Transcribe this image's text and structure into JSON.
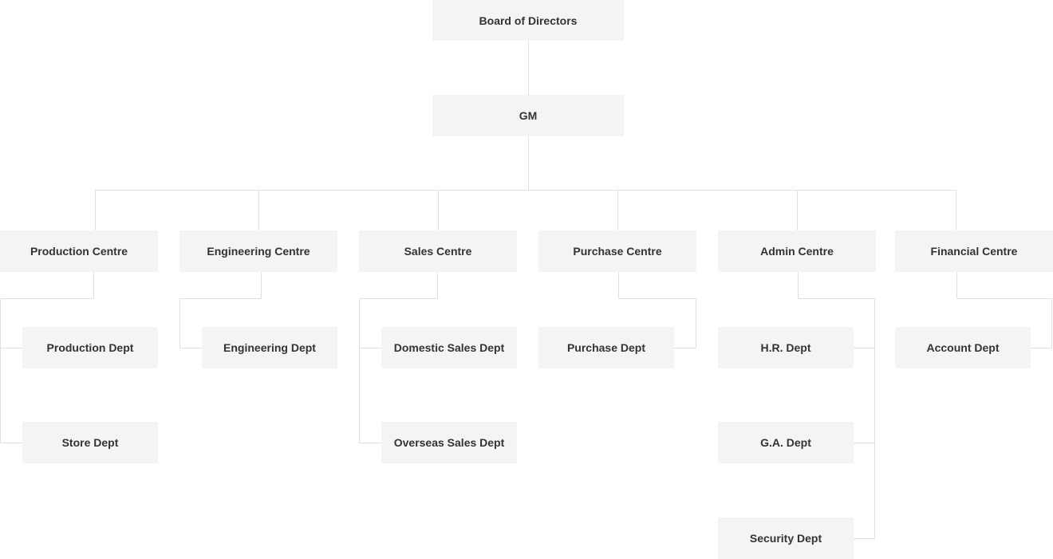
{
  "chart": {
    "root": "Board of Directors",
    "gm": "GM",
    "centres": [
      {
        "label": "Production Centre",
        "depts": [
          "Production Dept",
          "Store Dept"
        ]
      },
      {
        "label": "Engineering Centre",
        "depts": [
          "Engineering Dept"
        ]
      },
      {
        "label": "Sales Centre",
        "depts": [
          "Domestic Sales Dept",
          "Overseas Sales Dept"
        ]
      },
      {
        "label": "Purchase Centre",
        "depts": [
          "Purchase Dept"
        ]
      },
      {
        "label": "Admin Centre",
        "depts": [
          "H.R. Dept",
          "G.A. Dept",
          "Security Dept"
        ]
      },
      {
        "label": "Financial Centre",
        "depts": [
          "Account Dept"
        ]
      }
    ]
  },
  "colors": {
    "node_bg": "#f4f4f4",
    "connector": "#e0e0e0",
    "text": "#333333"
  }
}
